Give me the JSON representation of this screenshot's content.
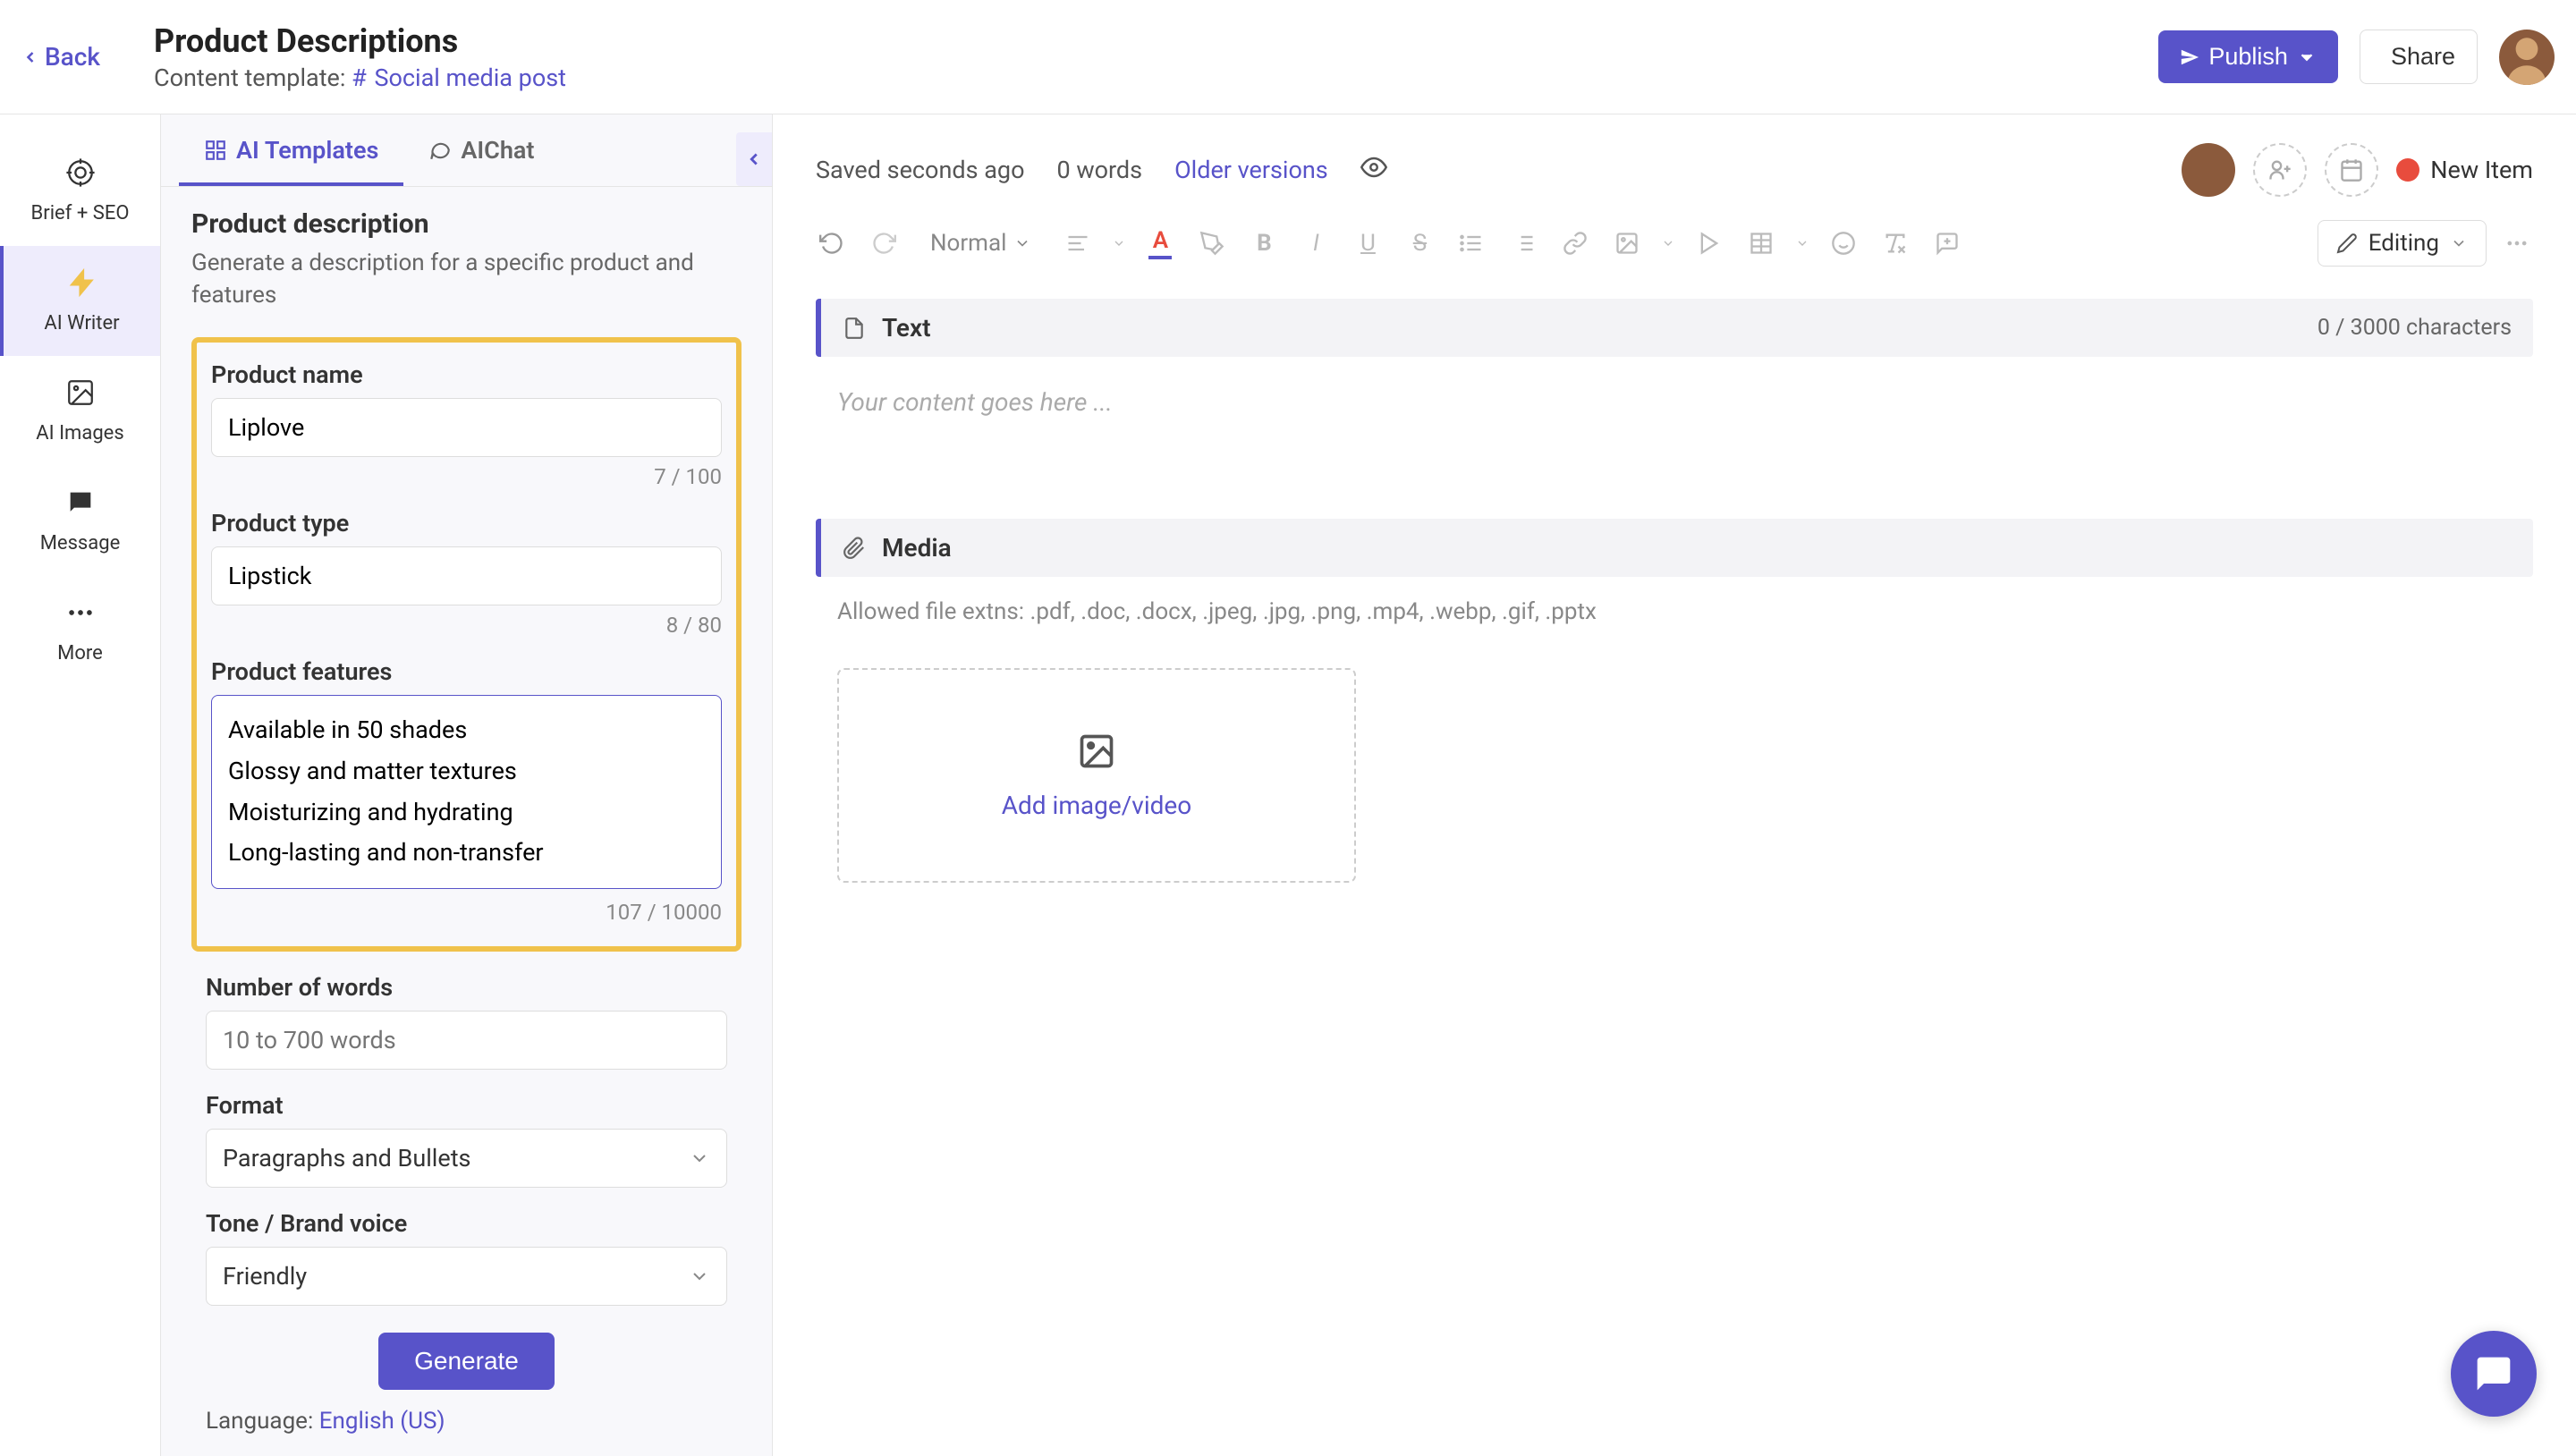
{
  "header": {
    "back": "Back",
    "title": "Product Descriptions",
    "template_label": "Content template:",
    "template_link": "Social media post",
    "publish": "Publish",
    "share": "Share"
  },
  "rail": {
    "brief": "Brief + SEO",
    "writer": "AI Writer",
    "images": "AI Images",
    "message": "Message",
    "more": "More"
  },
  "panel": {
    "tab_templates": "AI Templates",
    "tab_chat": "AIChat",
    "title": "Product description",
    "subtitle": "Generate a description for a specific product and features",
    "product_name_label": "Product name",
    "product_name_value": "Liplove",
    "product_name_count": "7 / 100",
    "product_type_label": "Product type",
    "product_type_value": "Lipstick",
    "product_type_count": "8 / 80",
    "features_label": "Product features",
    "features_value": "Available in 50 shades\nGlossy and matter textures\nMoisturizing and hydrating\nLong-lasting and non-transfer",
    "features_count": "107 / 10000",
    "words_label": "Number of words",
    "words_placeholder": "10 to 700 words",
    "format_label": "Format",
    "format_value": "Paragraphs and Bullets",
    "tone_label": "Tone / Brand voice",
    "tone_value": "Friendly",
    "generate": "Generate",
    "language_label": "Language:",
    "language_value": "English (US)"
  },
  "editor": {
    "saved": "Saved seconds ago",
    "words": "0 words",
    "older": "Older versions",
    "status": "New Item",
    "normal": "Normal",
    "editing": "Editing",
    "text_section": "Text",
    "char_meter": "0 / 3000 characters",
    "placeholder": "Your content goes here ...",
    "media_section": "Media",
    "media_note": "Allowed file extns: .pdf, .doc, .docx, .jpeg, .jpg, .png, .mp4, .webp, .gif, .pptx",
    "upload_text": "Add image/video"
  }
}
